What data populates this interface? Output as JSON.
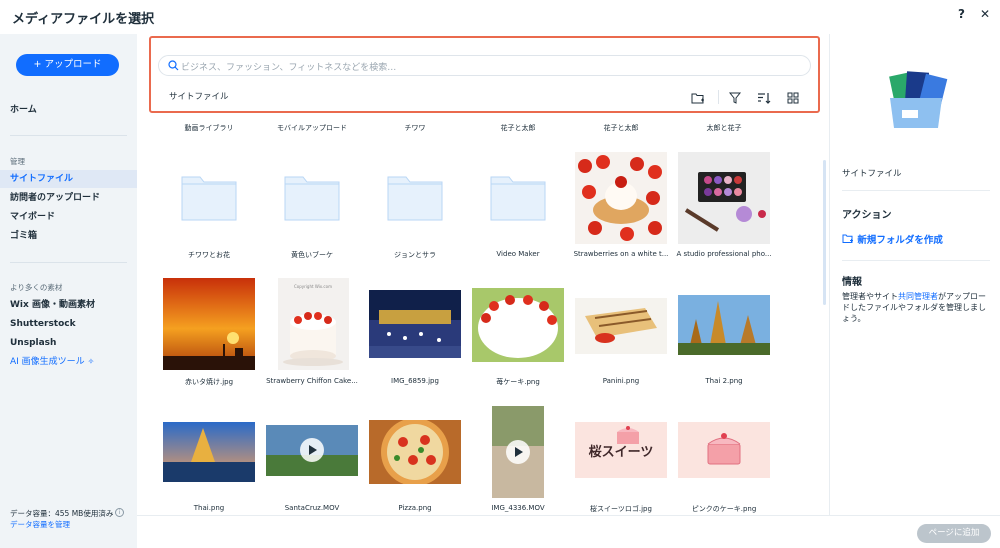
{
  "header": {
    "title": "メディアファイルを選択",
    "help": "?",
    "close": "✕"
  },
  "sidebar": {
    "upload": "+ アップロード",
    "home": "ホーム",
    "manage_section": "管理",
    "items": [
      "サイトファイル",
      "訪問者のアップロード",
      "マイボード",
      "ゴミ箱"
    ],
    "more_section": "より多くの素材",
    "more_items": [
      "Wix 画像・動画素材",
      "Shutterstock",
      "Unsplash"
    ],
    "ai_item": "AI 画像生成ツール",
    "storage": "データ容量：455 MB使用済み",
    "storage_link": "データ容量を管理"
  },
  "search": {
    "placeholder": "ビジネス、ファッション、フィットネスなどを検索…",
    "breadcrumb": "サイトファイル"
  },
  "grid": {
    "top_labels": [
      "動画ライブラリ",
      "モバイルアップロード",
      "チワワ",
      "花子と太郎",
      "花子と太郎",
      "太郎と花子"
    ],
    "row1": [
      "チワワとお花",
      "黄色いブーケ",
      "ジョンとサラ",
      "Video Maker",
      "Strawberries on a white t...",
      "A studio professional pho..."
    ],
    "row2": [
      "赤いタ焼け.jpg",
      "Strawberry Chiffon Cake...",
      "IMG_6859.jpg",
      "苺ケーキ.png",
      "Panini.png",
      "Thai 2.png"
    ],
    "row3": [
      "Thai.png",
      "SantaCruz.MOV",
      "Pizza.png",
      "IMG_4336.MOV",
      "桜スイーツロゴ.jpg",
      "ピンクのケーキ.png"
    ],
    "logo_text": "桜スイーツ",
    "cake_caption": "Copyright Wix.com"
  },
  "right_panel": {
    "title": "サイトファイル",
    "actions_heading": "アクション",
    "new_folder": "新規フォルダを作成",
    "info_heading": "情報",
    "info_before": "管理者やサイト",
    "info_link": "共同管理者",
    "info_after": "がアップロードしたファイルやフォルダを管理しましょう。"
  },
  "footer": {
    "add": "ページに追加"
  }
}
